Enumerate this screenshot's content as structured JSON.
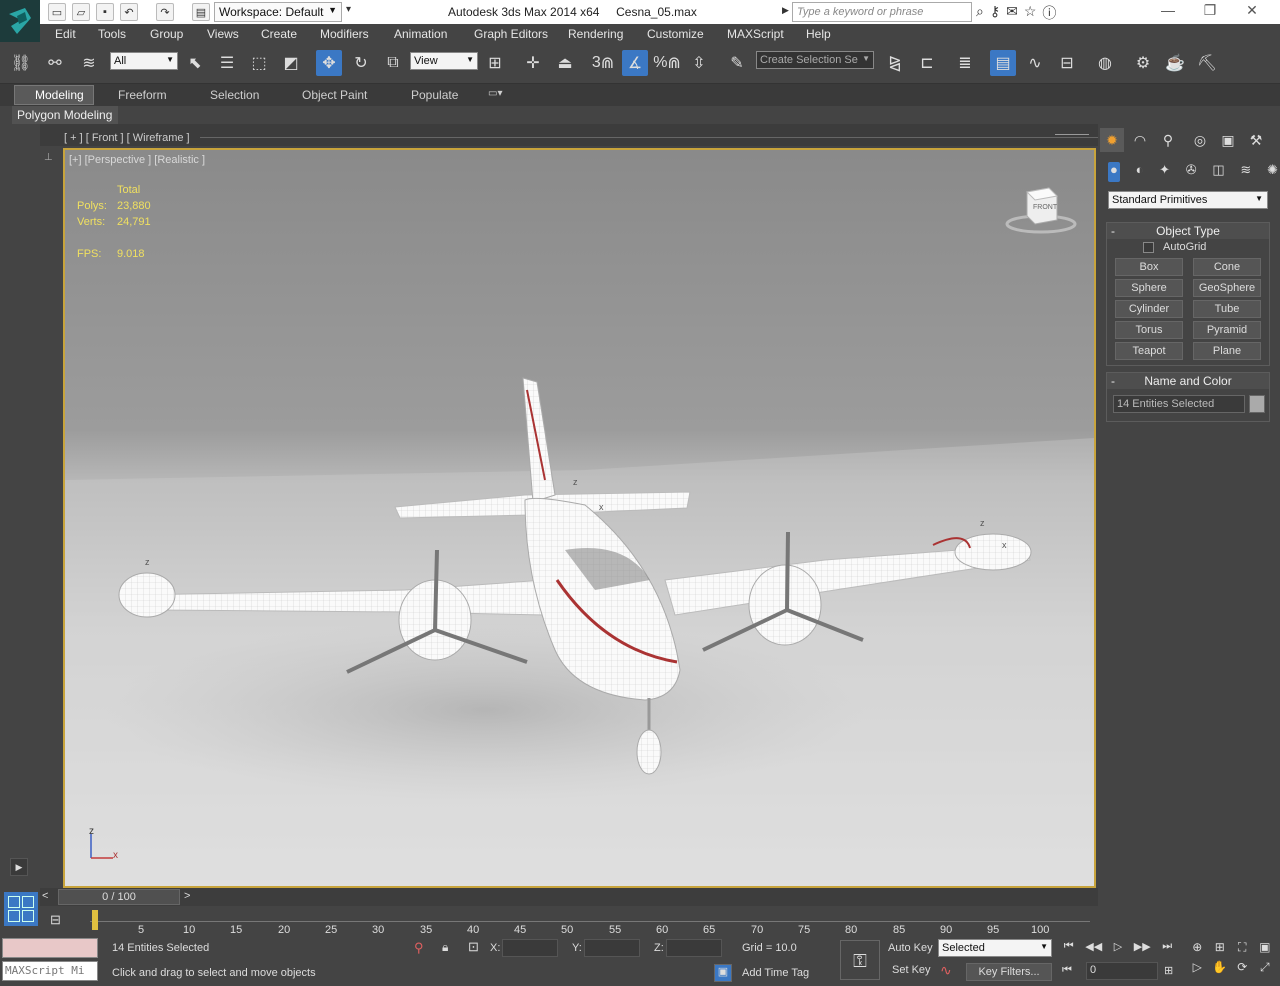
{
  "title_bar": {
    "app_title": "Autodesk 3ds Max  2014 x64",
    "file_name": "Cesna_05.max",
    "workspace": "Workspace: Default",
    "search_placeholder": "Type a keyword or phrase"
  },
  "menu": [
    "Edit",
    "Tools",
    "Group",
    "Views",
    "Create",
    "Modifiers",
    "Animation",
    "Graph Editors",
    "Rendering",
    "Customize",
    "MAXScript",
    "Help"
  ],
  "toolbar": {
    "filter_value": "All",
    "reference_coord": "View",
    "selection_set_placeholder": "Create Selection Se",
    "snap_label": "3",
    "percent_label": "%"
  },
  "ribbon": {
    "tabs": [
      "Modeling",
      "Freeform",
      "Selection",
      "Object Paint",
      "Populate"
    ],
    "active_tab": "Modeling",
    "panel_label": "Polygon Modeling"
  },
  "viewports": {
    "top_strip_label": "[ + ] [ Front ] [ Wireframe ]",
    "main_label": "[+] [Perspective ] [Realistic ]",
    "viewcube_label": "FRONT"
  },
  "stats": {
    "header": "Total",
    "polys_label": "Polys:",
    "polys": "23,880",
    "verts_label": "Verts:",
    "verts": "24,791",
    "fps_label": "FPS:",
    "fps": "9.018"
  },
  "axis_labels": {
    "z": "z",
    "x": "x"
  },
  "command_panel": {
    "category": "Standard Primitives",
    "object_type_title": "Object Type",
    "autogrid_label": "AutoGrid",
    "buttons": [
      "Box",
      "Cone",
      "Sphere",
      "GeoSphere",
      "Cylinder",
      "Tube",
      "Torus",
      "Pyramid",
      "Teapot",
      "Plane"
    ],
    "name_color_title": "Name and Color",
    "name_value": "14 Entities Selected",
    "minus": "-"
  },
  "time_slider": {
    "label": "0 / 100",
    "left_arrow": "<",
    "right_arrow": ">"
  },
  "timeline_ticks": [
    "5",
    "10",
    "15",
    "20",
    "25",
    "30",
    "35",
    "40",
    "45",
    "50",
    "55",
    "60",
    "65",
    "70",
    "75",
    "80",
    "85",
    "90",
    "95",
    "100"
  ],
  "status": {
    "selection_info": "14 Entities Selected",
    "prompt": "Click and drag to select and move objects",
    "maxscript_placeholder": "MAXScript Mi",
    "x_label": "X:",
    "y_label": "Y:",
    "z_label": "Z:",
    "grid": "Grid = 10.0",
    "add_time_tag": "Add Time Tag",
    "auto_key": "Auto Key",
    "set_key": "Set Key",
    "key_mode": "Selected",
    "key_filters": "Key Filters...",
    "frame": "0"
  },
  "colors": {
    "accent_blue": "#3b78c4",
    "viewport_border": "#c8a43c",
    "stats_yellow": "#f0e060",
    "titlebar_bg": "#ffffff",
    "ui_bg": "#444444"
  }
}
